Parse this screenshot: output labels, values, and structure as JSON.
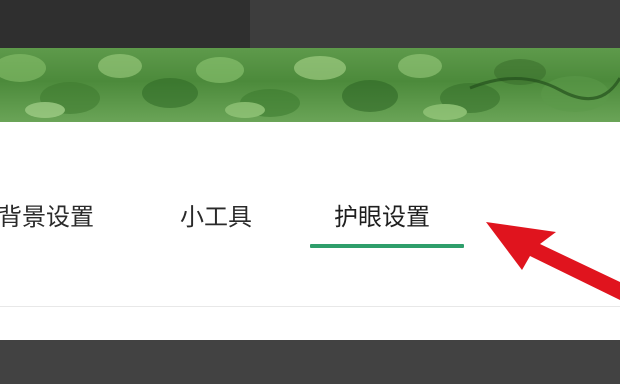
{
  "tabs": [
    {
      "label": "背景设置",
      "active": false
    },
    {
      "label": "小工具",
      "active": false
    },
    {
      "label": "护眼设置",
      "active": true
    }
  ],
  "colors": {
    "active_underline": "#2e9e6b",
    "arrow": "#e0141e",
    "banner": "#4c8a3b"
  },
  "icons": {
    "pointer_arrow": "red-arrow-icon"
  }
}
